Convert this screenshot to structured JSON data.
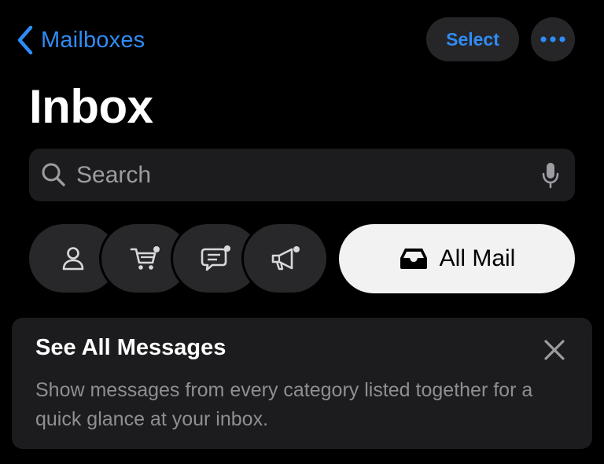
{
  "nav": {
    "back_label": "Mailboxes",
    "select_label": "Select",
    "more_icon": "ellipsis-icon"
  },
  "title": "Inbox",
  "search": {
    "placeholder": "Search",
    "icon": "search-icon",
    "mic_icon": "microphone-icon"
  },
  "categories": [
    {
      "icon": "person-icon",
      "badge": false
    },
    {
      "icon": "shopping-cart-icon",
      "badge": true
    },
    {
      "icon": "chat-bubble-icon",
      "badge": true
    },
    {
      "icon": "megaphone-icon",
      "badge": true
    }
  ],
  "all_mail": {
    "label": "All Mail",
    "icon": "tray-icon"
  },
  "banner": {
    "title": "See All Messages",
    "body": "Show messages from every category listed together for a quick glance at your inbox.",
    "close_icon": "close-icon"
  },
  "colors": {
    "accent": "#2f8cf6",
    "background": "#000000",
    "surface": "#1c1c1e",
    "chip": "#28282a",
    "selected_chip": "#f2f2f2",
    "secondary_text": "#8e8e93"
  }
}
